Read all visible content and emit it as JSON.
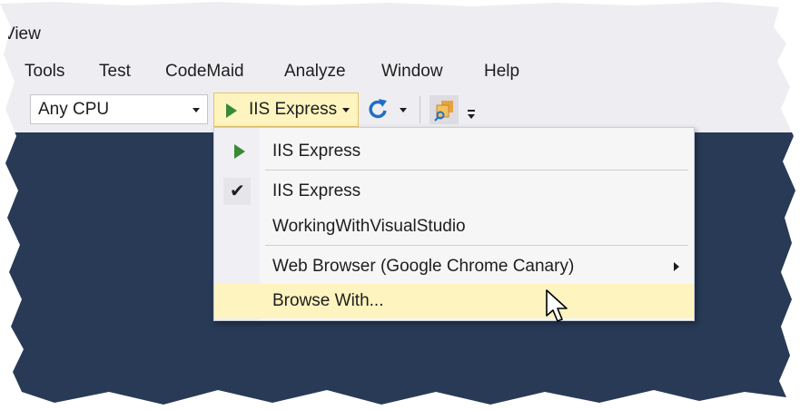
{
  "menubar": {
    "top_item": "View",
    "items": [
      {
        "label": "Tools"
      },
      {
        "label": "Test"
      },
      {
        "label": "CodeMaid"
      },
      {
        "label": "Analyze"
      },
      {
        "label": "Window"
      },
      {
        "label": "Help"
      }
    ]
  },
  "toolbar": {
    "platform_value": "Any CPU",
    "run_label": "IIS Express",
    "icons": [
      "play-icon",
      "refresh-icon",
      "browser-link-icon",
      "overflow-icon"
    ]
  },
  "dropdown": {
    "items": [
      {
        "label": "IIS Express",
        "icon": "play-icon"
      },
      {
        "label": "IIS Express",
        "icon": "checkmark-icon",
        "checked": true
      },
      {
        "label": "WorkingWithVisualStudio"
      },
      {
        "label": "Web Browser (Google Chrome Canary)",
        "submenu": true
      },
      {
        "label": "Browse With...",
        "highlighted": true
      }
    ]
  },
  "colors": {
    "chrome": "#eeeef2",
    "editor": "#283a56",
    "highlight": "#fdf4bf",
    "play_green": "#388a34"
  }
}
